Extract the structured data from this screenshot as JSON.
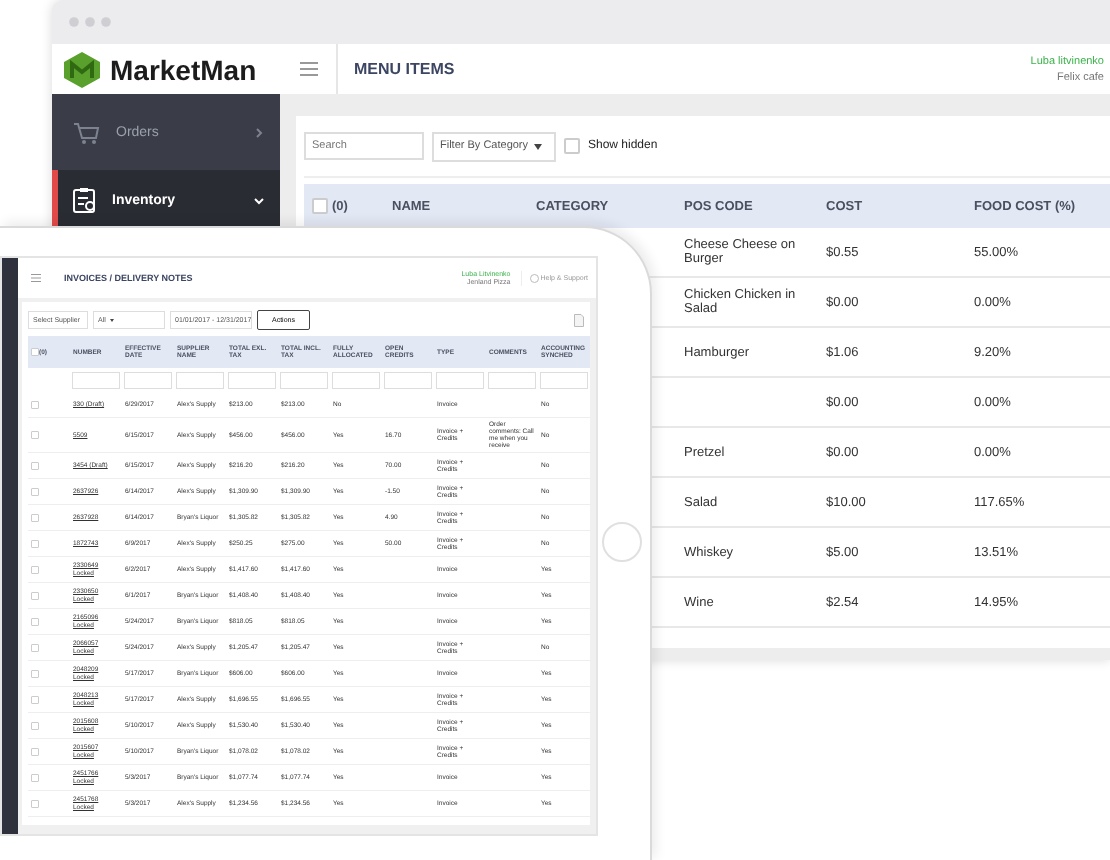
{
  "window": {
    "logo": "MarketMan",
    "title": "MENU ITEMS",
    "user": "Luba litvinenko",
    "account": "Felix cafe"
  },
  "sidebar": {
    "items": [
      {
        "label": "Orders",
        "selected": false,
        "expanded": false
      },
      {
        "label": "Inventory",
        "selected": true,
        "expanded": true
      }
    ]
  },
  "toolbar": {
    "search": {
      "placeholder": "Search"
    },
    "filter": "Filter By Category",
    "show_hidden": {
      "label": "Show hidden",
      "checked": false
    }
  },
  "table": {
    "select_all": {
      "label": "(0)",
      "checked": false
    },
    "columns": [
      "NAME",
      "CATEGORY",
      "POS CODE",
      "COST",
      "FOOD COST (%)"
    ],
    "rows": [
      {
        "pos_code": "Cheese Cheese on Burger",
        "cost": "$0.55",
        "food_cost": "55.00%"
      },
      {
        "pos_code": "Chicken Chicken in Salad",
        "cost": "$0.00",
        "food_cost": "0.00%"
      },
      {
        "pos_code": "Hamburger",
        "cost": "$1.06",
        "food_cost": "9.20%"
      },
      {
        "pos_code": "",
        "cost": "$0.00",
        "food_cost": "0.00%"
      },
      {
        "pos_code": "Pretzel",
        "cost": "$0.00",
        "food_cost": "0.00%"
      },
      {
        "pos_code": "Salad",
        "cost": "$10.00",
        "food_cost": "117.65%"
      },
      {
        "pos_code": "Whiskey",
        "cost": "$5.00",
        "food_cost": "13.51%"
      },
      {
        "pos_code": "Wine",
        "cost": "$2.54",
        "food_cost": "14.95%"
      }
    ]
  },
  "tablet": {
    "title": "INVOICES / DELIVERY NOTES",
    "user": "Luba Litvinenko",
    "account": "Jenland Pizza",
    "help": "Help & Support",
    "filters": {
      "supplier": "Select Supplier",
      "type": "All",
      "dates": "01/01/2017 - 12/31/2017",
      "actions": "Actions"
    },
    "select_all": {
      "label": "(0)",
      "checked": false
    },
    "columns": [
      "NUMBER",
      "EFFECTIVE DATE",
      "SUPPLIER NAME",
      "TOTAL EXL. TAX",
      "TOTAL INCL. TAX",
      "FULLY ALLOCATED",
      "OPEN CREDITS",
      "TYPE",
      "COMMENTS",
      "ACCOUNTING SYNCHED"
    ],
    "rows": [
      {
        "checked": false,
        "cells": [
          "330 (Draft)",
          "6/29/2017",
          "Alex's Supply",
          "$213.00",
          "$213.00",
          "No",
          "",
          "Invoice",
          "",
          "No"
        ]
      },
      {
        "checked": false,
        "cells": [
          "5509",
          "6/15/2017",
          "Alex's Supply",
          "$456.00",
          "$456.00",
          "Yes",
          "16.70",
          "Invoice + Credits",
          "Order comments: Call me when you receive",
          "No"
        ]
      },
      {
        "checked": false,
        "cells": [
          "3454 (Draft)",
          "6/15/2017",
          "Alex's Supply",
          "$216.20",
          "$216.20",
          "Yes",
          "70.00",
          "Invoice + Credits",
          "",
          "No"
        ]
      },
      {
        "checked": false,
        "cells": [
          "2637926",
          "6/14/2017",
          "Alex's Supply",
          "$1,309.90",
          "$1,309.90",
          "Yes",
          "-1.50",
          "Invoice + Credits",
          "",
          "No"
        ]
      },
      {
        "checked": false,
        "cells": [
          "2637928",
          "6/14/2017",
          "Bryan's Liquor",
          "$1,305.82",
          "$1,305.82",
          "Yes",
          "4.90",
          "Invoice + Credits",
          "",
          "No"
        ]
      },
      {
        "checked": false,
        "cells": [
          "1872743",
          "6/9/2017",
          "Alex's Supply",
          "$250.25",
          "$275.00",
          "Yes",
          "50.00",
          "Invoice + Credits",
          "",
          "No"
        ]
      },
      {
        "checked": false,
        "status": "Locked",
        "cells": [
          "2330649",
          "6/2/2017",
          "Alex's Supply",
          "$1,417.60",
          "$1,417.60",
          "Yes",
          "",
          "Invoice",
          "",
          "Yes"
        ]
      },
      {
        "checked": false,
        "status": "Locked",
        "cells": [
          "2330650",
          "6/1/2017",
          "Bryan's Liquor",
          "$1,408.40",
          "$1,408.40",
          "Yes",
          "",
          "Invoice",
          "",
          "Yes"
        ]
      },
      {
        "checked": false,
        "status": "Locked",
        "cells": [
          "2165096",
          "5/24/2017",
          "Bryan's Liquor",
          "$818.05",
          "$818.05",
          "Yes",
          "",
          "Invoice",
          "",
          "Yes"
        ]
      },
      {
        "checked": false,
        "status": "Locked",
        "cells": [
          "2066057",
          "5/24/2017",
          "Alex's Supply",
          "$1,205.47",
          "$1,205.47",
          "Yes",
          "",
          "Invoice + Credits",
          "",
          "No"
        ]
      },
      {
        "checked": false,
        "status": "Locked",
        "cells": [
          "2048209",
          "5/17/2017",
          "Bryan's Liquor",
          "$606.00",
          "$606.00",
          "Yes",
          "",
          "Invoice",
          "",
          "Yes"
        ]
      },
      {
        "checked": false,
        "status": "Locked",
        "cells": [
          "2048213",
          "5/17/2017",
          "Alex's Supply",
          "$1,696.55",
          "$1,696.55",
          "Yes",
          "",
          "Invoice + Credits",
          "",
          "Yes"
        ]
      },
      {
        "checked": false,
        "status": "Locked",
        "cells": [
          "2015608",
          "5/10/2017",
          "Alex's Supply",
          "$1,530.40",
          "$1,530.40",
          "Yes",
          "",
          "Invoice + Credits",
          "",
          "Yes"
        ]
      },
      {
        "checked": false,
        "status": "Locked",
        "cells": [
          "2015607",
          "5/10/2017",
          "Bryan's Liquor",
          "$1,078.02",
          "$1,078.02",
          "Yes",
          "",
          "Invoice + Credits",
          "",
          "Yes"
        ]
      },
      {
        "checked": false,
        "status": "Locked",
        "cells": [
          "2451766",
          "5/3/2017",
          "Bryan's Liquor",
          "$1,077.74",
          "$1,077.74",
          "Yes",
          "",
          "Invoice",
          "",
          "Yes"
        ]
      },
      {
        "checked": false,
        "status": "Locked",
        "cells": [
          "2451768",
          "5/3/2017",
          "Alex's Supply",
          "$1,234.56",
          "$1,234.56",
          "Yes",
          "",
          "Invoice",
          "",
          "Yes"
        ]
      }
    ]
  }
}
